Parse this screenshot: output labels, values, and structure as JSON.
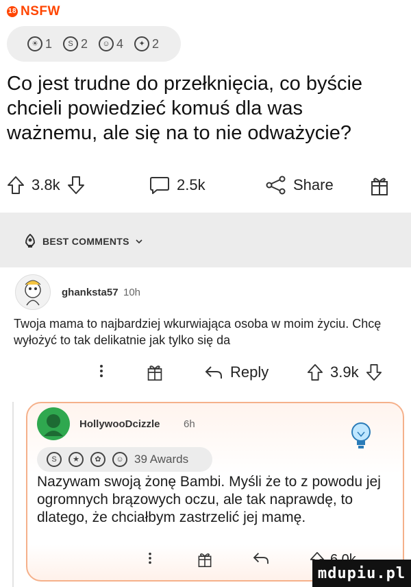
{
  "nsfw": {
    "label": "NSFW"
  },
  "post": {
    "awards": [
      {
        "icon": "sun-award-icon",
        "count": "1"
      },
      {
        "icon": "silver-award-icon",
        "count": "2"
      },
      {
        "icon": "wholesome-award-icon",
        "count": "4"
      },
      {
        "icon": "helpful-award-icon",
        "count": "2"
      }
    ],
    "title": "Co jest trudne do przełknięcia, co byście chcieli powiedzieć komuś dla was ważnemu, ale się na to nie odważycie?",
    "upvotes": "3.8k",
    "comments": "2.5k",
    "share_label": "Share"
  },
  "best_comments_label": "BEST COMMENTS",
  "comment1": {
    "username": "ghanksta57",
    "time": "10h",
    "text": "Twoja mama to najbardziej wkurwiająca osoba w moim życiu. Chcę wyłożyć to tak delikatnie jak tylko się da",
    "reply_label": "Reply",
    "score": "3.9k"
  },
  "comment2": {
    "username": "HollywooDcizzle",
    "time": "6h",
    "awards_label": "39 Awards",
    "text": "Nazywam swoją żonę Bambi. Myśli że to z powodu jej ogromnych brązowych oczu, ale tak naprawdę, to dlatego, że chciałbym zastrzelić jej mamę.",
    "score": "6.0k"
  },
  "watermark": "mdupiu.pl",
  "colors": {
    "accent": "#ff4500",
    "highlight_border": "#f5b08a",
    "separator": "#ececec"
  }
}
